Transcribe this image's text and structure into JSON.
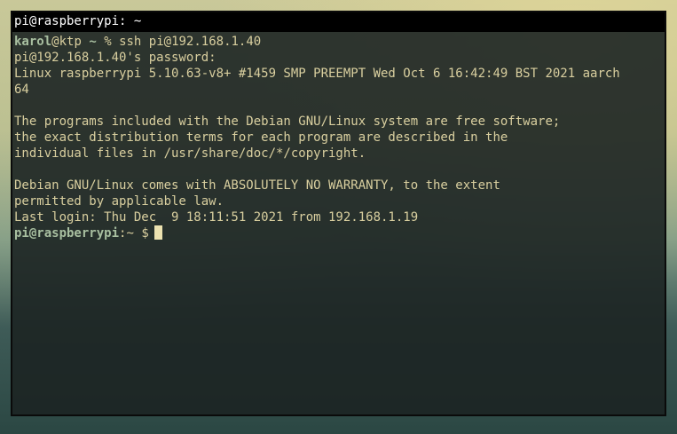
{
  "window": {
    "title": "pi@raspberrypi: ~"
  },
  "terminal": {
    "local_prompt": {
      "user_host": "karol",
      "at_host": "@ktp",
      "path": "~",
      "symbol": "%",
      "command": "ssh pi@192.168.1.40"
    },
    "lines": {
      "password_prompt": "pi@192.168.1.40's password:",
      "uname_1": "Linux raspberrypi 5.10.63-v8+ #1459 SMP PREEMPT Wed Oct 6 16:42:49 BST 2021 aarch",
      "uname_2": "64",
      "motd_1": "The programs included with the Debian GNU/Linux system are free software;",
      "motd_2": "the exact distribution terms for each program are described in the",
      "motd_3": "individual files in /usr/share/doc/*/copyright.",
      "motd_4": "Debian GNU/Linux comes with ABSOLUTELY NO WARRANTY, to the extent",
      "motd_5": "permitted by applicable law.",
      "last_login": "Last login: Thu Dec  9 18:11:51 2021 from 192.168.1.19"
    },
    "remote_prompt": {
      "user_host": "pi@raspberrypi",
      "path": ":~",
      "symbol": "$"
    }
  },
  "colors": {
    "title_bar": "#000000",
    "title_text": "#ffffff",
    "text": "#d9cf9f",
    "prompt": "#a8bfa0",
    "cursor": "#ece2b0"
  }
}
